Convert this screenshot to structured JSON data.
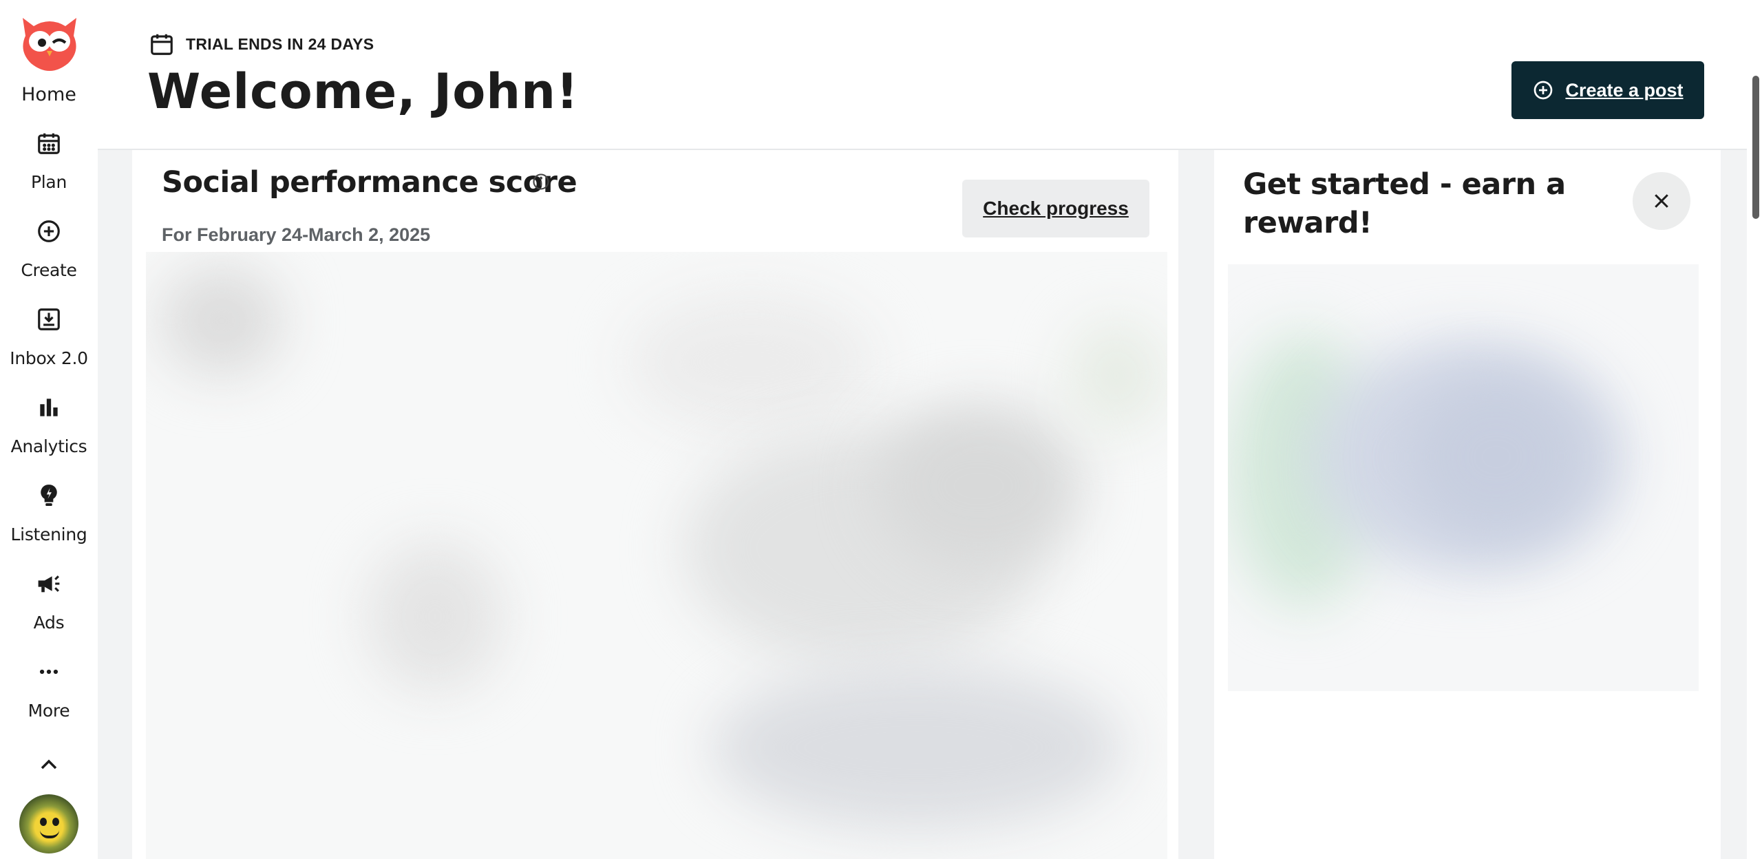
{
  "sidebar": {
    "home_label": "Home",
    "items": [
      {
        "label": "Plan",
        "icon": "calendar-icon"
      },
      {
        "label": "Create",
        "icon": "plus-circle-icon"
      },
      {
        "label": "Inbox 2.0",
        "icon": "inbox-icon"
      },
      {
        "label": "Analytics",
        "icon": "bar-chart-icon"
      },
      {
        "label": "Listening",
        "icon": "lightbulb-icon"
      },
      {
        "label": "Ads",
        "icon": "megaphone-icon"
      },
      {
        "label": "More",
        "icon": "more-dots-icon"
      }
    ]
  },
  "header": {
    "trial_text": "TRIAL ENDS IN 24 DAYS",
    "welcome": "Welcome, John!",
    "create_post_label": "Create a post"
  },
  "score_card": {
    "title": "Social performance score",
    "date_range": "For February 24-March 2, 2025",
    "check_label": "Check progress"
  },
  "reward_card": {
    "title": "Get started - earn a reward!"
  },
  "colors": {
    "brand_red": "#f2534a",
    "primary_button": "#0c2832",
    "secondary_button": "#ecedee",
    "content_bg": "#f2f3f4"
  }
}
